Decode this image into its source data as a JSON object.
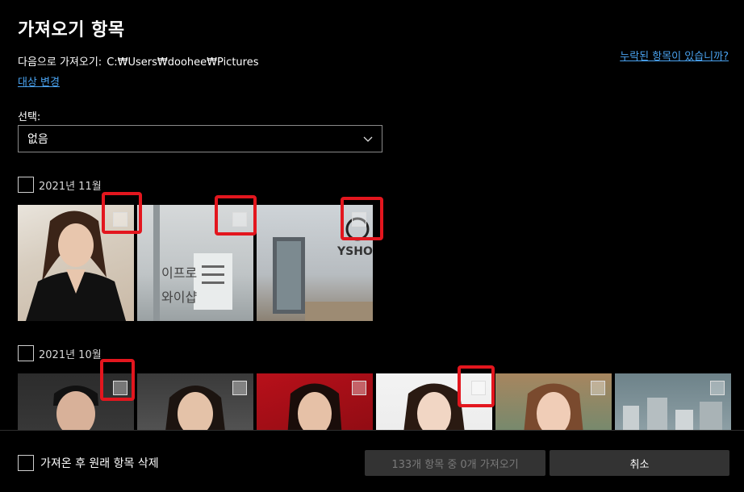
{
  "header": {
    "title": "가져오기 항목",
    "dest_label": "다음으로 가져오기:",
    "dest_path": "C:₩Users₩doohee₩Pictures",
    "change_dest_link": "대상 변경",
    "missing_link": "누락된 항목이 있습니까?"
  },
  "select": {
    "label": "선택:",
    "value": "없음"
  },
  "groups": [
    {
      "label": "2021년 11월",
      "photo_count_visible": 3
    },
    {
      "label": "2021년 10월",
      "photo_count_visible": 6
    }
  ],
  "footer": {
    "delete_after_label": "가져온 후 원래 항목 삭제",
    "import_button": "133개 항목 중 0개 가져오기",
    "cancel_button": "취소"
  },
  "colors": {
    "background": "#000000",
    "link": "#4aa3f0",
    "highlight": "#e3161e",
    "button_bg": "#333333"
  }
}
